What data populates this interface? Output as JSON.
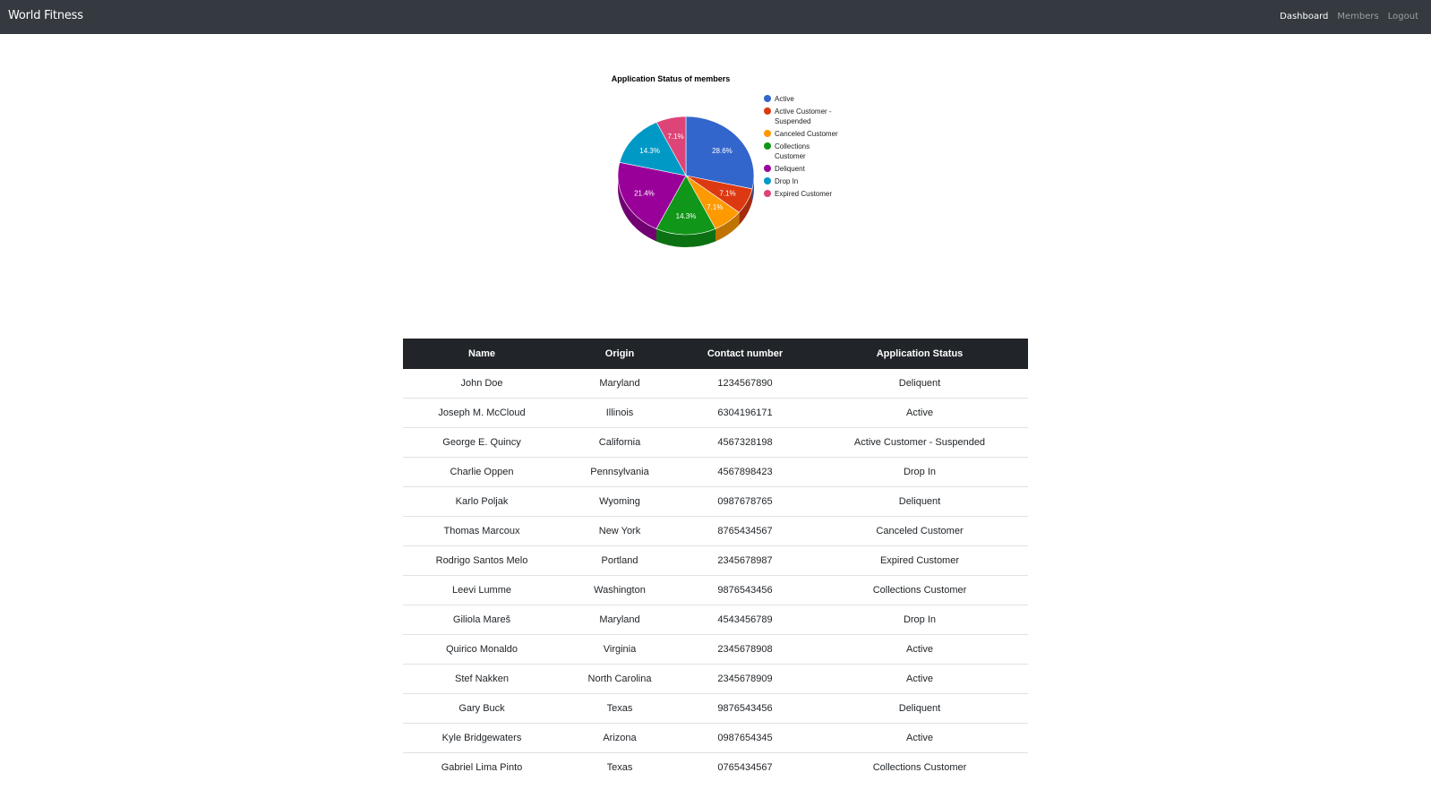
{
  "navbar": {
    "brand": "World Fitness",
    "links": [
      "Dashboard",
      "Members",
      "Logout"
    ],
    "active": "Dashboard"
  },
  "chart_data": {
    "type": "pie",
    "title": "Application Status of members",
    "legend_position": "right",
    "slices": [
      {
        "label": "Active",
        "value": 28.6,
        "color": "#3366cc",
        "display": "28.6%"
      },
      {
        "label": "Active Customer - Suspended",
        "value": 7.1,
        "color": "#dc3912",
        "display": "7.1%"
      },
      {
        "label": "Canceled Customer",
        "value": 7.1,
        "color": "#ff9900",
        "display": "7.1%"
      },
      {
        "label": "Collections Customer",
        "value": 14.3,
        "color": "#109618",
        "display": "14.3%"
      },
      {
        "label": "Deliquent",
        "value": 21.4,
        "color": "#990099",
        "display": "21.4%"
      },
      {
        "label": "Drop In",
        "value": 14.3,
        "color": "#0099c6",
        "display": "14.3%"
      },
      {
        "label": "Expired Customer",
        "value": 7.1,
        "color": "#dd4477",
        "display": "7.1%"
      }
    ]
  },
  "table": {
    "headers": [
      "Name",
      "Origin",
      "Contact number",
      "Application Status"
    ],
    "rows": [
      [
        "John Doe",
        "Maryland",
        "1234567890",
        "Deliquent"
      ],
      [
        "Joseph M. McCloud",
        "Illinois",
        "6304196171",
        "Active"
      ],
      [
        "George E. Quincy",
        "California",
        "4567328198",
        "Active Customer - Suspended"
      ],
      [
        "Charlie Oppen",
        "Pennsylvania",
        "4567898423",
        "Drop In"
      ],
      [
        "Karlo Poljak",
        "Wyoming",
        "0987678765",
        "Deliquent"
      ],
      [
        "Thomas Marcoux",
        "New York",
        "8765434567",
        "Canceled Customer"
      ],
      [
        "Rodrigo Santos Melo",
        "Portland",
        "2345678987",
        "Expired Customer"
      ],
      [
        "Leevi Lumme",
        "Washington",
        "9876543456",
        "Collections Customer"
      ],
      [
        "Giliola Mareš",
        "Maryland",
        "4543456789",
        "Drop In"
      ],
      [
        "Quirico Monaldo",
        "Virginia",
        "2345678908",
        "Active"
      ],
      [
        "Stef Nakken",
        "North Carolina",
        "2345678909",
        "Active"
      ],
      [
        "Gary Buck",
        "Texas",
        "9876543456",
        "Deliquent"
      ],
      [
        "Kyle Bridgewaters",
        "Arizona",
        "0987654345",
        "Active"
      ],
      [
        "Gabriel Lima Pinto",
        "Texas",
        "0765434567",
        "Collections Customer"
      ]
    ]
  }
}
